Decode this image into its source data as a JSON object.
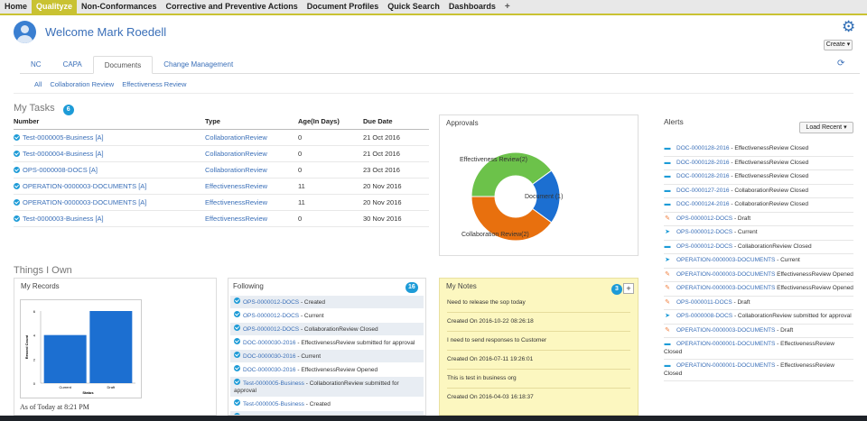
{
  "nav": {
    "items": [
      "Home",
      "Qualityze",
      "Non-Conformances",
      "Corrective and Preventive Actions",
      "Document Profiles",
      "Quick Search",
      "Dashboards"
    ],
    "active_index": 1,
    "plus": "+"
  },
  "header": {
    "welcome": "Welcome Mark Roedell",
    "create": "Create ▾"
  },
  "tabs": [
    "NC",
    "CAPA",
    "Documents",
    "Change Management"
  ],
  "active_tab": 2,
  "subtabs": [
    "All",
    "Collaboration Review",
    "Effectiveness Review"
  ],
  "tasks": {
    "title": "My Tasks",
    "count": "6",
    "columns": [
      "Number",
      "Type",
      "Age(In Days)",
      "Due Date"
    ],
    "rows": [
      [
        "Test-0000005-Business [A]",
        "CollaborationReview",
        "0",
        "21 Oct 2016"
      ],
      [
        "Test-0000004-Business [A]",
        "CollaborationReview",
        "0",
        "21 Oct 2016"
      ],
      [
        "OPS-0000008-DOCS [A]",
        "CollaborationReview",
        "0",
        "23 Oct 2016"
      ],
      [
        "OPERATION-0000003-DOCUMENTS [A]",
        "EffectivenessReview",
        "11",
        "20 Nov 2016"
      ],
      [
        "OPERATION-0000003-DOCUMENTS [A]",
        "EffectivenessReview",
        "11",
        "20 Nov 2016"
      ],
      [
        "Test-0000003-Business [A]",
        "EffectivenessReview",
        "0",
        "30 Nov 2016"
      ]
    ]
  },
  "approvals": {
    "title": "Approvals",
    "chart_data": {
      "type": "pie",
      "labels": [
        "Effectiveness Review(2)",
        "Document (1)",
        "Collaboration Review(2)"
      ],
      "values": [
        2,
        1,
        2
      ],
      "colors": [
        "#6cc24a",
        "#1c6fd1",
        "#e8700e"
      ]
    }
  },
  "alerts": {
    "title": "Alerts",
    "load": "Load Recent ▾",
    "items": [
      {
        "icon": "folder",
        "link": "DOC-0000128-2016",
        "text": " - EffectivenessReview Closed"
      },
      {
        "icon": "folder",
        "link": "DOC-0000128-2016",
        "text": " - EffectivenessReview Closed"
      },
      {
        "icon": "folder",
        "link": "DOC-0000128-2016",
        "text": " - EffectivenessReview Closed"
      },
      {
        "icon": "folder",
        "link": "DOC-0000127-2016",
        "text": " - CollaborationReview Closed"
      },
      {
        "icon": "folder",
        "link": "DOC-0000124-2016",
        "text": " - CollaborationReview Closed"
      },
      {
        "icon": "edit",
        "link": "OPS-0000012-DOCS",
        "text": " - Draft"
      },
      {
        "icon": "send",
        "link": "OPS-0000012-DOCS",
        "text": " - Current"
      },
      {
        "icon": "folder",
        "link": "OPS-0000012-DOCS",
        "text": " - CollaborationReview Closed"
      },
      {
        "icon": "send",
        "link": "OPERATION-0000003-DOCUMENTS",
        "text": " - Current"
      },
      {
        "icon": "edit",
        "link": "OPERATION-0000003-DOCUMENTS",
        "text": " EffectivenessReview Opened"
      },
      {
        "icon": "edit",
        "link": "OPERATION-0000003-DOCUMENTS",
        "text": " EffectivenessReview Opened"
      },
      {
        "icon": "edit",
        "link": "OPS-0000011-DOCS",
        "text": " - Draft"
      },
      {
        "icon": "send",
        "link": "OPS-0000008-DOCS",
        "text": " - CollaborationReview submitted for approval"
      },
      {
        "icon": "edit",
        "link": "OPERATION-0000003-DOCUMENTS",
        "text": " - Draft"
      },
      {
        "icon": "folder",
        "link": "OPERATION-0000001-DOCUMENTS",
        "text": " - EffectivenessReview Closed"
      },
      {
        "icon": "folder",
        "link": "OPERATION-0000001-DOCUMENTS",
        "text": " - EffectivenessReview Closed"
      }
    ]
  },
  "things": {
    "title": "Things I Own"
  },
  "records": {
    "title": "My Records",
    "footer": "As of Today at 8:21 PM",
    "chart_data": {
      "type": "bar",
      "categories": [
        "Current",
        "Draft"
      ],
      "values": [
        4,
        6
      ],
      "ylim": [
        0,
        6
      ],
      "ylabel": "Record Count",
      "xlabel": "Status",
      "yticks": [
        "0",
        "2",
        "4",
        "6"
      ]
    }
  },
  "following": {
    "title": "Following",
    "count": "16",
    "items": [
      {
        "link": "OPS-0000012-DOCS",
        "text": " - Created"
      },
      {
        "link": "OPS-0000012-DOCS",
        "text": " - Current"
      },
      {
        "link": "OPS-0000012-DOCS",
        "text": " - CollaborationReview Closed"
      },
      {
        "link": "DOC-0000030-2016",
        "text": " - EffectivenessReview submitted for approval"
      },
      {
        "link": "DOC-0000030-2016",
        "text": " - Current"
      },
      {
        "link": "DOC-0000030-2016",
        "text": " - EffectivenessReview Opened"
      },
      {
        "link": "Test-0000005-Business",
        "text": " - CollaborationReview submitted for approval"
      },
      {
        "link": "Test-0000005-Business",
        "text": " - Created"
      },
      {
        "link": "DOC-0000030-2016",
        "text": " - Created"
      }
    ]
  },
  "notes": {
    "title": "My Notes",
    "count": "3",
    "plus": "+",
    "items": [
      {
        "text": "Need to release the sop today",
        "created": "Created On 2016-10-22 08:26:18"
      },
      {
        "text": "I need to send responses to Customer",
        "created": "Created On 2016-07-11 19:26:01"
      },
      {
        "text": "This is test in business org",
        "created": "Created On 2016-04-03 16:18:37"
      }
    ]
  }
}
